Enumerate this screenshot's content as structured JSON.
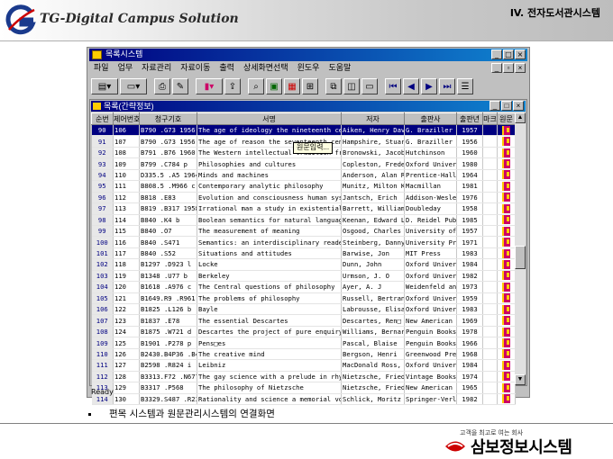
{
  "slide": {
    "logo_text": "TG-Digital Campus Solution",
    "section_title": "IV. 전자도서관시스템",
    "caption": "편목 시스템과 원문관리시스템의  연결화면",
    "slogan": "고객을 최고로 여는 회사",
    "brand": "삼보정보시스템"
  },
  "app": {
    "title": "목록시스템",
    "menu": [
      "파일",
      "업무",
      "자료관리",
      "자료이동",
      "출력",
      "상세화면선택",
      "윈도우",
      "도움말"
    ],
    "status": "Ready"
  },
  "child": {
    "title": "목록(간략정보)",
    "tooltip": "원문입력..."
  },
  "table": {
    "columns": [
      "순번",
      "제어번호",
      "청구기호",
      "서명",
      "저자",
      "출판사",
      "출판년",
      "마크",
      "원문"
    ],
    "selected_row": 0,
    "rows": [
      {
        "no": "90",
        "ctrl": "106",
        "call": "B790 .G73 1956",
        "title": "The age of ideology the nineteenth century",
        "author": "Aiken, Henry David",
        "pub": "G. Braziller",
        "year": "1957"
      },
      {
        "no": "91",
        "ctrl": "107",
        "call": "B790 .G73 1956",
        "title": "The age of reason the seventeenth century p",
        "author": "Hampshire, Stuart",
        "pub": "G. Braziller",
        "year": "1956"
      },
      {
        "no": "92",
        "ctrl": "108",
        "call": "B791 .B76 1960",
        "title": "The Western intellectual tradition from Leo",
        "author": "Bronowski, Jacob",
        "pub": "Hutchinson",
        "year": "1960"
      },
      {
        "no": "93",
        "ctrl": "109",
        "call": "B799 .C784 p",
        "title": "Philosophies and cultures",
        "author": "Copleston, Frederic",
        "pub": "Oxford Universit",
        "year": "1980"
      },
      {
        "no": "94",
        "ctrl": "110",
        "call": "D335.5 .A5 1964",
        "title": "Minds and machines",
        "author": "Anderson, Alan Ross",
        "pub": "Prentice-Hall",
        "year": "1964"
      },
      {
        "no": "95",
        "ctrl": "111",
        "call": "B808.5 .M966 c",
        "title": "Contemporary analytic philosophy",
        "author": "Munitz, Milton Karl",
        "pub": "Macmillan",
        "year": "1981"
      },
      {
        "no": "96",
        "ctrl": "112",
        "call": "B818 .E83",
        "title": "Evolution and consciousness  human systems",
        "author": "Jantsch, Erich",
        "pub": "Addison-Wesley",
        "year": "1976"
      },
      {
        "no": "97",
        "ctrl": "113",
        "call": "B819 .B317 1958",
        "title": "Irrational man a study in existential philo",
        "author": "Barrett, William",
        "pub": "Doubleday",
        "year": "1958"
      },
      {
        "no": "98",
        "ctrl": "114",
        "call": "B840 .K4 b",
        "title": "Boolean semantics for natural language",
        "author": "Keenan, Edward L",
        "pub": "D. Reidel Pub. C",
        "year": "1985"
      },
      {
        "no": "99",
        "ctrl": "115",
        "call": "B840 .O7",
        "title": "The measurement of meaning",
        "author": "Osgood, Charles Eg",
        "pub": "University of I",
        "year": "1957"
      },
      {
        "no": "100",
        "ctrl": "116",
        "call": "B840 .S471",
        "title": "Semantics: an interdisciplinary reader in p",
        "author": "Steinberg, Danny D",
        "pub": "University Pres",
        "year": "1971"
      },
      {
        "no": "101",
        "ctrl": "117",
        "call": "B840 .S52",
        "title": "Situations and attitudes",
        "author": "Barwise, Jon",
        "pub": "MIT Press",
        "year": "1983"
      },
      {
        "no": "102",
        "ctrl": "118",
        "call": "B1297 .D923 l",
        "title": "Locke",
        "author": "Dunn, John",
        "pub": "Oxford Universit",
        "year": "1984"
      },
      {
        "no": "103",
        "ctrl": "119",
        "call": "B1348 .U77 b",
        "title": "Berkeley",
        "author": "Urmson, J. O",
        "pub": "Oxford Universit",
        "year": "1982"
      },
      {
        "no": "104",
        "ctrl": "120",
        "call": "B1618 .A976 c",
        "title": "The Central questions of philosophy",
        "author": "Ayer, A. J",
        "pub": "Weidenfeld and N",
        "year": "1973"
      },
      {
        "no": "105",
        "ctrl": "121",
        "call": "B1649.R9 .R961 p",
        "title": "The problems of philosophy",
        "author": "Russell, Bertrand",
        "pub": "Oxford Universit",
        "year": "1959"
      },
      {
        "no": "106",
        "ctrl": "122",
        "call": "B1825 .L126 b",
        "title": "Bayle",
        "author": "Labrousse, Elisabet",
        "pub": "Oxford Universit",
        "year": "1983"
      },
      {
        "no": "107",
        "ctrl": "123",
        "call": "B1837 .E78",
        "title": "The essential Descartes",
        "author": "Descartes, Ren□",
        "pub": "New American Lib",
        "year": "1969"
      },
      {
        "no": "108",
        "ctrl": "124",
        "call": "B1875 .W721 d",
        "title": "Descartes  the project of pure enquiry",
        "author": "Williams, Bernard A",
        "pub": "Penguin Books",
        "year": "1978"
      },
      {
        "no": "109",
        "ctrl": "125",
        "call": "B1901 .P278 p",
        "title": "Pens□es",
        "author": "Pascal, Blaise",
        "pub": "Penguin Books",
        "year": "1966"
      },
      {
        "no": "110",
        "ctrl": "126",
        "call": "B2430.B4P36 .B49",
        "title": "The creative mind",
        "author": "Bergson, Henri",
        "pub": "Greenwood Press",
        "year": "1968"
      },
      {
        "no": "111",
        "ctrl": "127",
        "call": "B2598 .R824 i",
        "title": "Leibniz",
        "author": "MacDonald Ross, G",
        "pub": "Oxford Universit",
        "year": "1984"
      },
      {
        "no": "112",
        "ctrl": "128",
        "call": "B3313.F72 .N677",
        "title": "The gay science with a prelude in rhymes an",
        "author": "Nietzsche, Friedri",
        "pub": "Vintage Books",
        "year": "1974"
      },
      {
        "no": "113",
        "ctrl": "129",
        "call": "B3317 .P568",
        "title": "The philosophy of Nietzsche",
        "author": "Nietzsche, Friedri",
        "pub": "New American Lib",
        "year": "1965"
      },
      {
        "no": "114",
        "ctrl": "130",
        "call": "B3329.S487 .R236",
        "title": "Rationality and science  a memorial volume",
        "author": "Schlick, Moritz",
        "pub": "Springer-Verlag",
        "year": "1982"
      }
    ]
  }
}
